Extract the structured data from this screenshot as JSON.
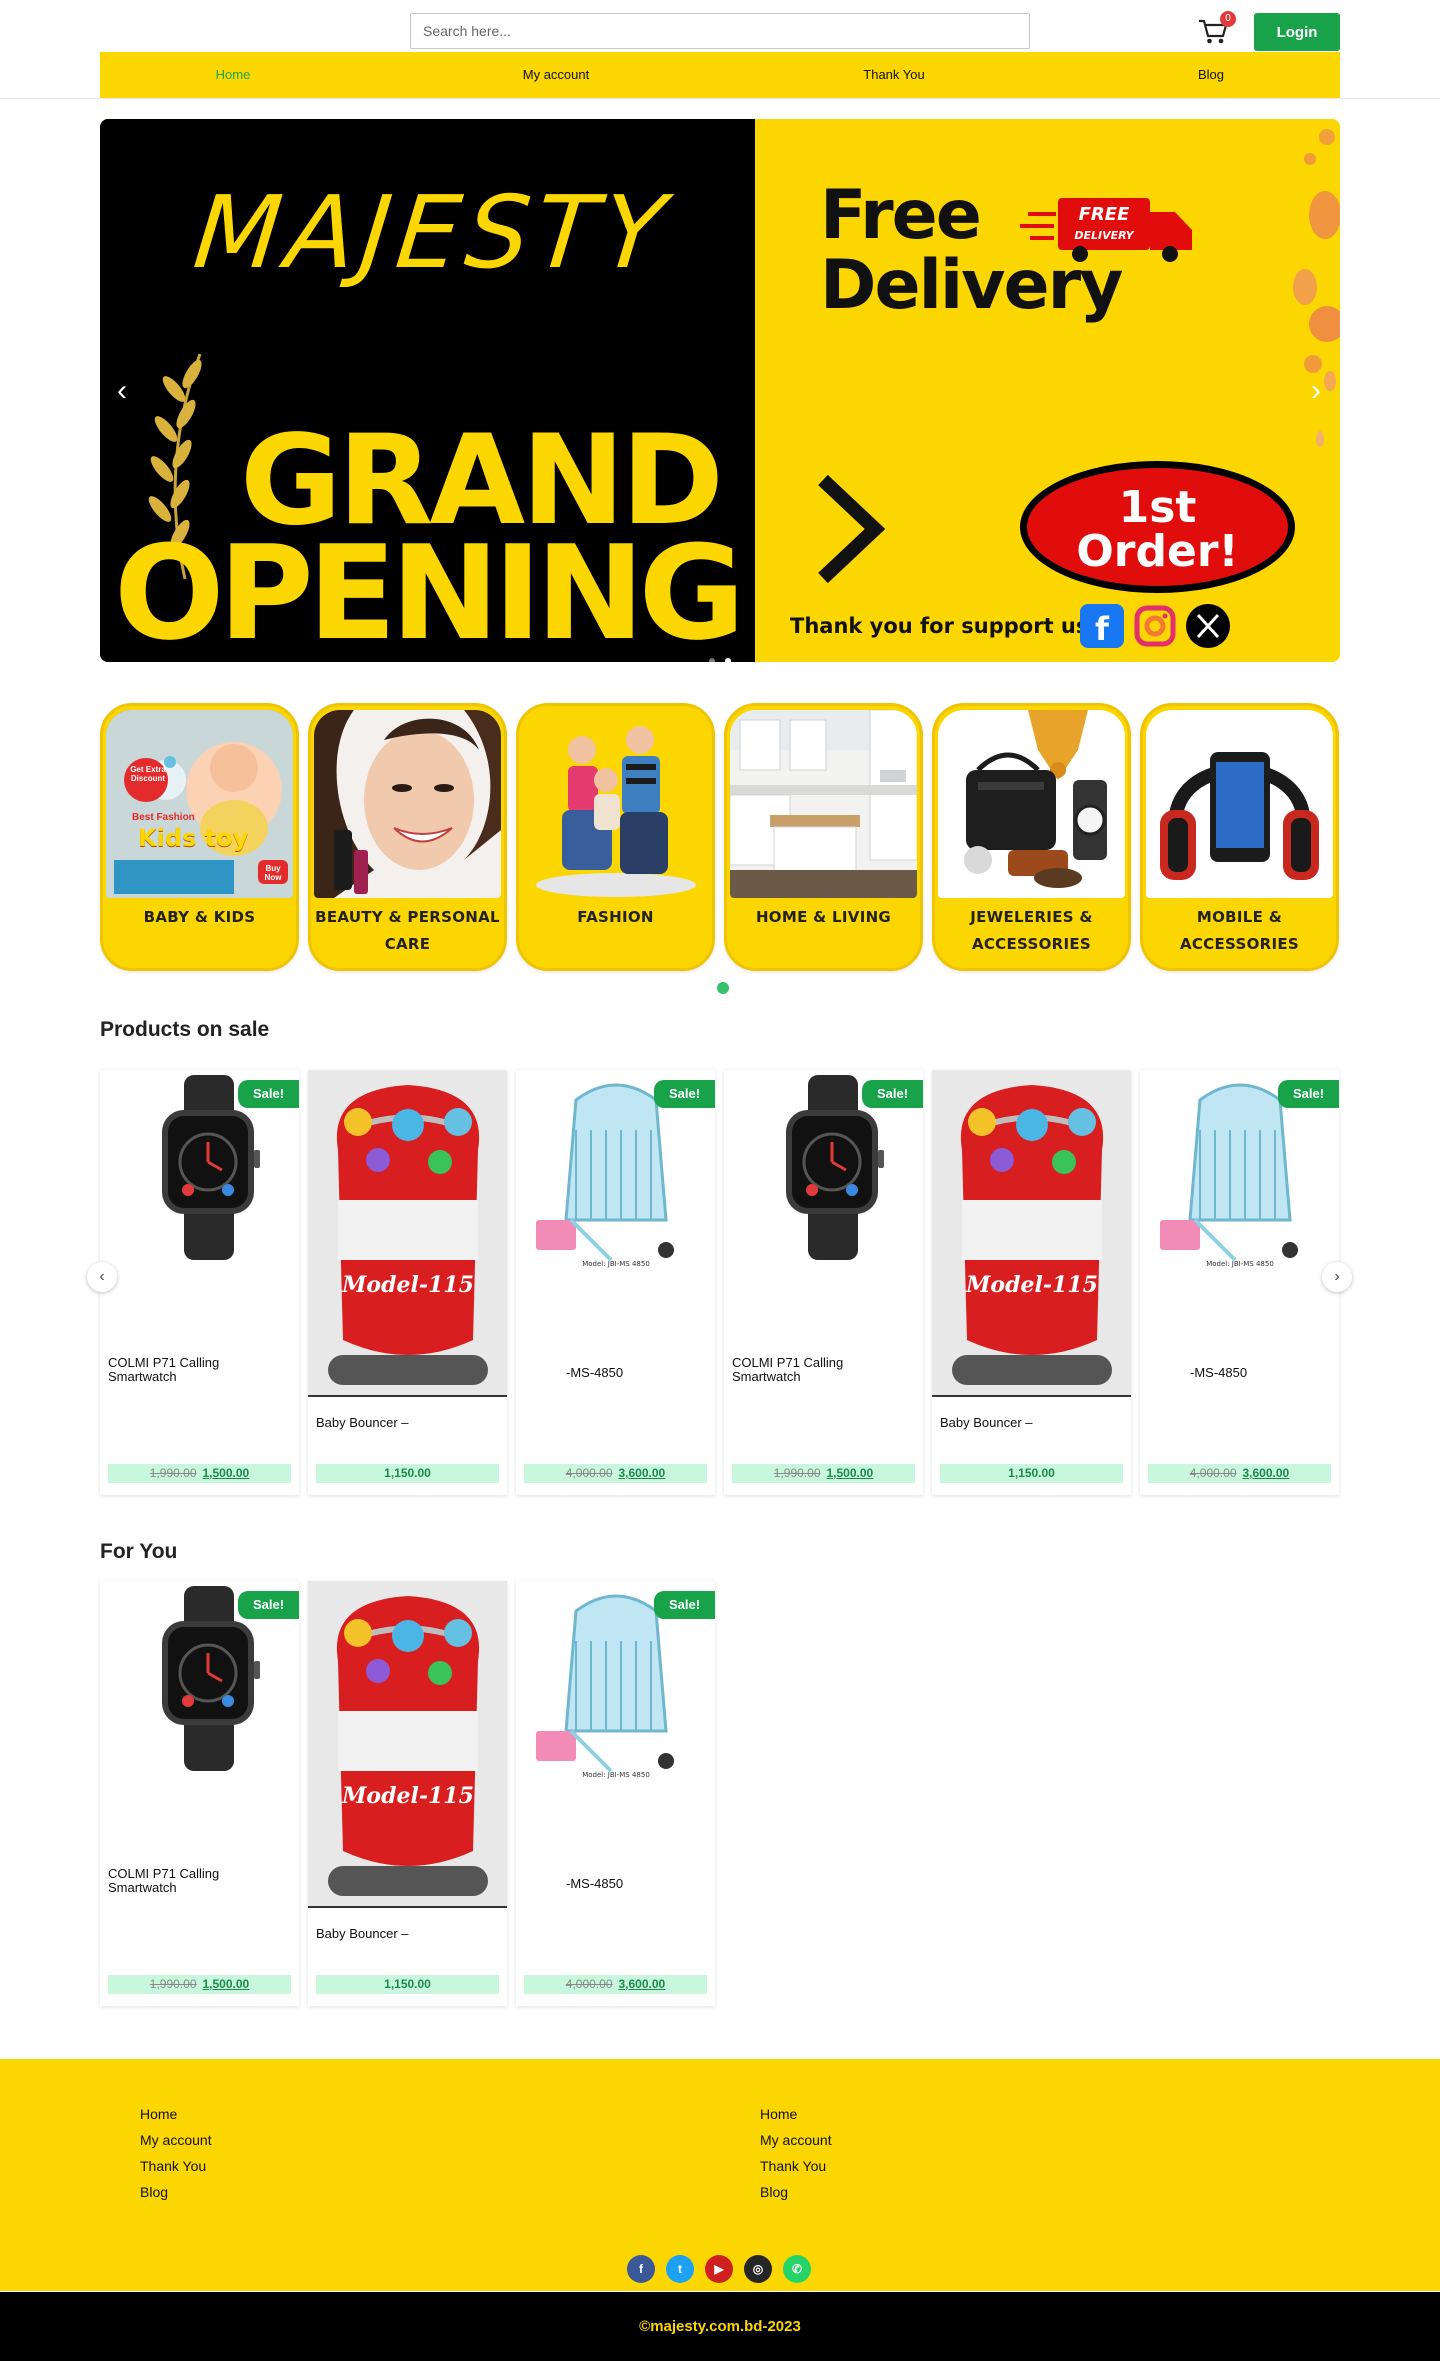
{
  "header": {
    "search_placeholder": "Search here...",
    "cart_count": "0",
    "login_label": "Login"
  },
  "nav": [
    {
      "label": "Home",
      "active": true
    },
    {
      "label": "My account",
      "active": false
    },
    {
      "label": "Thank You",
      "active": false
    },
    {
      "label": "Blog",
      "active": false
    }
  ],
  "hero": {
    "brand": "MAJESTY",
    "line1": "GRAND",
    "line2": "OPENING",
    "free_delivery_1": "Free",
    "free_delivery_2": "Delivery",
    "badge": "FREE DELIVERY",
    "order_1": "1st",
    "order_2": "Order!",
    "thanks": "Thank you for support us!",
    "prev": "‹",
    "next": "›",
    "slides": 2,
    "active_slide": 2
  },
  "categories": [
    {
      "label": "BABY & KIDS",
      "image": "kids-toy-banner"
    },
    {
      "label": "BEAUTY & PERSONAL CARE",
      "image": "smiling-woman"
    },
    {
      "label": "FASHION",
      "image": "friends-group"
    },
    {
      "label": "HOME & LIVING",
      "image": "kitchen-interior"
    },
    {
      "label": "JEWELERIES & ACCESSORIES",
      "image": "bag-watch-jewelry"
    },
    {
      "label": "MOBILE & ACCESSORIES",
      "image": "headphones-phone"
    }
  ],
  "kids_banner": {
    "discount": "Get Extra Discount",
    "title1": "Best Fashion",
    "title2": "Kids toy",
    "cta": "Buy Now"
  },
  "sections": {
    "sale_title": "Products on sale",
    "for_you_title": "For You"
  },
  "sale_badge": "Sale!",
  "products_on_sale": [
    {
      "name": "COLMI P71 Calling Smartwatch",
      "old_price": "1,990.00",
      "price": "1,500.00",
      "sale": true,
      "image": "smartwatch"
    },
    {
      "name": "Baby Bouncer –",
      "old_price": "",
      "price": "1,150.00",
      "sale": false,
      "image": "baby-bouncer"
    },
    {
      "name": "-MS-4850",
      "old_price": "4,000.00",
      "price": "3,600.00",
      "sale": true,
      "image": "baby-crib"
    },
    {
      "name": "COLMI P71 Calling Smartwatch",
      "old_price": "1,990.00",
      "price": "1,500.00",
      "sale": true,
      "image": "smartwatch"
    },
    {
      "name": "Baby Bouncer –",
      "old_price": "",
      "price": "1,150.00",
      "sale": false,
      "image": "baby-bouncer"
    },
    {
      "name": "-MS-4850",
      "old_price": "4,000.00",
      "price": "3,600.00",
      "sale": true,
      "image": "baby-crib"
    }
  ],
  "for_you": [
    {
      "name": "COLMI P71 Calling Smartwatch",
      "old_price": "1,990.00",
      "price": "1,500.00",
      "sale": true,
      "image": "smartwatch"
    },
    {
      "name": "Baby Bouncer –",
      "old_price": "",
      "price": "1,150.00",
      "sale": false,
      "image": "baby-bouncer"
    },
    {
      "name": "-MS-4850",
      "old_price": "4,000.00",
      "price": "3,600.00",
      "sale": true,
      "image": "baby-crib"
    }
  ],
  "bouncer_label": "Model-115",
  "footer": {
    "col1": [
      "Home",
      "My account",
      "Thank You",
      "Blog"
    ],
    "col2": [
      "Home",
      "My account",
      "Thank You",
      "Blog"
    ],
    "social": [
      {
        "name": "facebook-icon",
        "glyph": "f",
        "color": "#3b5998"
      },
      {
        "name": "twitter-icon",
        "glyph": "t",
        "color": "#1da1f2"
      },
      {
        "name": "youtube-icon",
        "glyph": "▶",
        "color": "#cd201f"
      },
      {
        "name": "instagram-icon",
        "glyph": "◎",
        "color": "#262626"
      },
      {
        "name": "whatsapp-icon",
        "glyph": "✆",
        "color": "#25d366"
      }
    ],
    "copyright": "©majesty.com.bd-2023"
  },
  "colors": {
    "brand_yellow": "#fbd600",
    "accent_green": "#18a34a",
    "price_bg": "#c9f7de"
  }
}
